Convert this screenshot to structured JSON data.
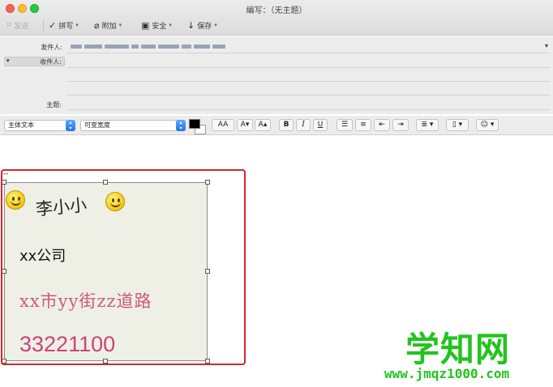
{
  "window": {
    "title": "编写：（无主题）"
  },
  "toolbar": {
    "send_label": "发送",
    "spelling_label": "拼写",
    "attach_label": "附加",
    "security_label": "安全",
    "save_label": "保存"
  },
  "header": {
    "from_label": "发件人:",
    "to_label": "收件人:",
    "subject_label": "主题:"
  },
  "format": {
    "style_value": "主体文本",
    "font_value": "可变宽度",
    "text_color": "#000000",
    "font_size_label": "AA",
    "decrease_size_label": "A▾",
    "increase_size_label": "A▴",
    "bold_label": "B",
    "italic_label": "I",
    "underline_label": "U"
  },
  "body": {
    "signature_separator": "--",
    "signature_name": "李小小",
    "signature_company": "xx公司",
    "signature_address": "xx市yy街zz道路",
    "signature_phone": "33221100"
  },
  "watermark": {
    "logo_text": "学知网",
    "url_text": "www.jmqz1000.com"
  },
  "colors": {
    "highlight_frame": "#d02a2a",
    "address_color": "#d2587a",
    "phone_color": "#cc4377",
    "watermark_color": "#22c41e"
  }
}
